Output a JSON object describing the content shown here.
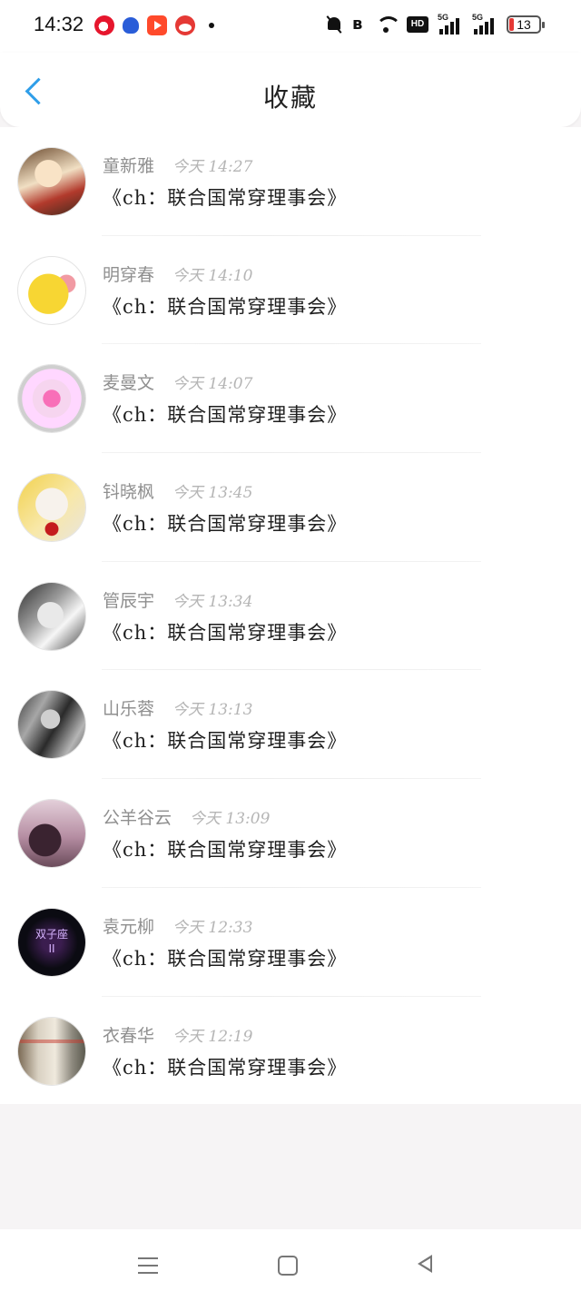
{
  "status_bar": {
    "time": "14:32",
    "battery_level": "13",
    "network_1": "5G",
    "network_2": "5G",
    "hd_label": "HD",
    "apps": [
      "weibo-icon",
      "baidu-icon",
      "video-app-icon",
      "santa-app-icon"
    ]
  },
  "header": {
    "title": "收藏",
    "back_icon": "chevron-left-icon"
  },
  "favorites": [
    {
      "sender": "童新雅",
      "time": "今天 14:27",
      "message": "《ch：联合国常穿理事会》"
    },
    {
      "sender": "明穿春",
      "time": "今天 14:10",
      "message": "《ch：联合国常穿理事会》"
    },
    {
      "sender": "麦曼文",
      "time": "今天 14:07",
      "message": "《ch：联合国常穿理事会》"
    },
    {
      "sender": "钭晓枫",
      "time": "今天 13:45",
      "message": "《ch：联合国常穿理事会》"
    },
    {
      "sender": "管辰宇",
      "time": "今天 13:34",
      "message": "《ch：联合国常穿理事会》"
    },
    {
      "sender": "山乐蓉",
      "time": "今天 13:13",
      "message": "《ch：联合国常穿理事会》"
    },
    {
      "sender": "公羊谷云",
      "time": "今天 13:09",
      "message": "《ch：联合国常穿理事会》"
    },
    {
      "sender": "袁元柳",
      "time": "今天 12:33",
      "message": "《ch：联合国常穿理事会》"
    },
    {
      "sender": "衣春华",
      "time": "今天 12:19",
      "message": "《ch：联合国常穿理事会》"
    }
  ],
  "avatar_labels": {
    "item_7": "双子座\nII"
  },
  "nav_bar": {
    "menu_icon": "menu-icon",
    "home_icon": "home-icon",
    "back_icon": "back-triangle-icon"
  },
  "colors": {
    "accent": "#2f9ee9",
    "sender_text": "#8f8f8f",
    "time_text": "#b5b5b5",
    "message_text": "#1f1f1f",
    "page_background": "#f6f4f5"
  }
}
